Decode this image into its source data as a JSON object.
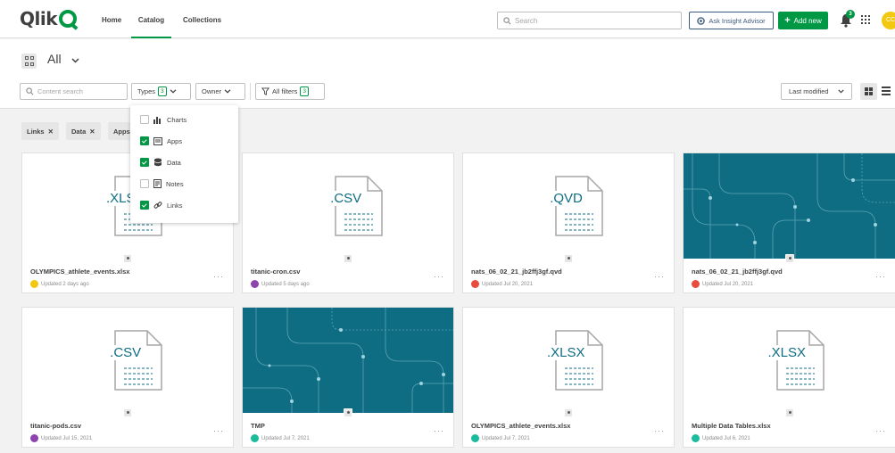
{
  "nav": {
    "brand": "Qlik",
    "tabs": [
      {
        "label": "Home",
        "active": false
      },
      {
        "label": "Catalog",
        "active": true
      },
      {
        "label": "Collections",
        "active": false
      }
    ],
    "search_placeholder": "Search",
    "insight_label": "Ask Insight Advisor",
    "add_new_label": "Add new",
    "notification_count": "3",
    "avatar_initials": "CC"
  },
  "header": {
    "space_title": "All",
    "content_search_placeholder": "Content search",
    "types_label": "Types",
    "types_count": "3",
    "owner_label": "Owner",
    "all_filters_label": "All filters",
    "all_filters_count": "3",
    "sort_label": "Last modified"
  },
  "chips": [
    {
      "label": "Links"
    },
    {
      "label": "Data"
    },
    {
      "label": "Apps"
    }
  ],
  "types_dropdown": [
    {
      "label": "Charts",
      "icon": "chart-icon",
      "checked": false
    },
    {
      "label": "Apps",
      "icon": "app-icon",
      "checked": true
    },
    {
      "label": "Data",
      "icon": "database-icon",
      "checked": true
    },
    {
      "label": "Notes",
      "icon": "note-icon",
      "checked": false
    },
    {
      "label": "Links",
      "icon": "link-icon",
      "checked": true
    }
  ],
  "cards": [
    {
      "title": "OLYMPICS_athlete_events.xlsx",
      "meta": "Updated 2 days ago",
      "ext": ".XLSX",
      "thumb": "file",
      "dot": "#f2c811"
    },
    {
      "title": "titanic-cron.csv",
      "meta": "Updated 5 days ago",
      "ext": ".CSV",
      "thumb": "file",
      "dot": "#8e44ad"
    },
    {
      "title": "nats_06_02_21_jb2ffj3gf.qvd",
      "meta": "Updated Jul 20, 2021",
      "ext": ".QVD",
      "thumb": "file",
      "dot": "#e74c3c"
    },
    {
      "title": "nats_06_02_21_jb2ffj3gf.qvd",
      "meta": "Updated Jul 20, 2021",
      "ext": "",
      "thumb": "pattern",
      "dot": "#e74c3c"
    },
    {
      "title": "titanic-pods.csv",
      "meta": "Updated Jul 15, 2021",
      "ext": ".CSV",
      "thumb": "file",
      "dot": "#8e44ad"
    },
    {
      "title": "TMP",
      "meta": "Updated Jul 7, 2021",
      "ext": "",
      "thumb": "pattern",
      "dot": "#1abc9c"
    },
    {
      "title": "OLYMPICS_athlete_events.xlsx",
      "meta": "Updated Jul 7, 2021",
      "ext": ".XLSX",
      "thumb": "file",
      "dot": "#1abc9c"
    },
    {
      "title": "Multiple Data Tables.xlsx",
      "meta": "Updated Jul 6, 2021",
      "ext": ".XLSX",
      "thumb": "file",
      "dot": "#1abc9c"
    }
  ],
  "colors": {
    "accent": "#009845",
    "thumb_teal": "#0e6d83",
    "insight_blue": "#3d5a80"
  }
}
